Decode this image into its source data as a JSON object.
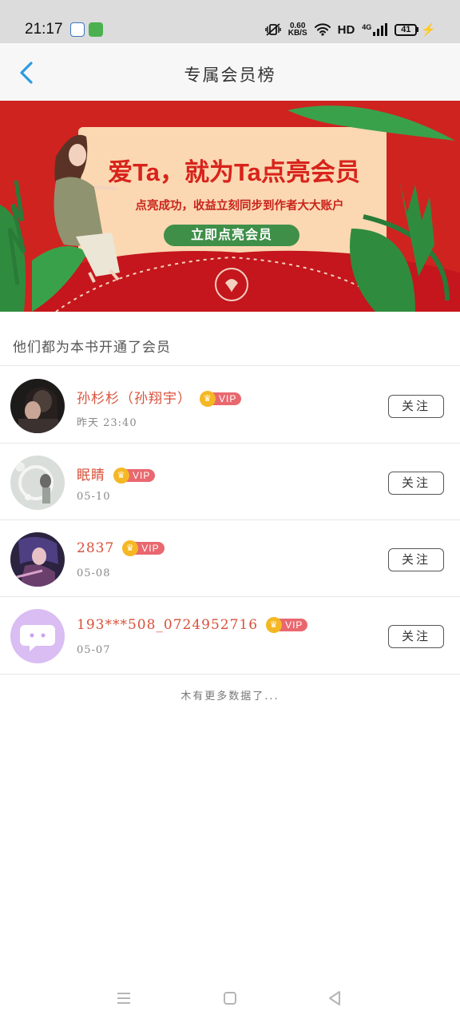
{
  "status_bar": {
    "time": "21:17",
    "net_speed_value": "0.60",
    "net_speed_unit": "KB/S",
    "hd_label": "HD",
    "network_type": "4G",
    "battery_level": "41"
  },
  "header": {
    "title": "专属会员榜"
  },
  "banner": {
    "headline": "爱Ta，就为Ta点亮会员",
    "subtext": "点亮成功，收益立刻同步到作者大大账户",
    "cta_label": "立即点亮会员"
  },
  "section_label": "他们都为本书开通了会员",
  "members": [
    {
      "name": "孙杉杉（孙翔宇）",
      "time": "昨天 23:40",
      "vip_label": "VIP",
      "follow_label": "关注"
    },
    {
      "name": "眠睛",
      "time": "05-10",
      "vip_label": "VIP",
      "follow_label": "关注"
    },
    {
      "name": "2837",
      "time": "05-08",
      "vip_label": "VIP",
      "follow_label": "关注"
    },
    {
      "name": "193***508_0724952716",
      "time": "05-07",
      "vip_label": "VIP",
      "follow_label": "关注"
    }
  ],
  "footer_text": "木有更多数据了...",
  "colors": {
    "accent_blue": "#2d9be0",
    "banner_red": "#cf2320",
    "name_red": "#d8503a",
    "vip_pink": "#e9686f",
    "vip_gold": "#f5b824"
  }
}
